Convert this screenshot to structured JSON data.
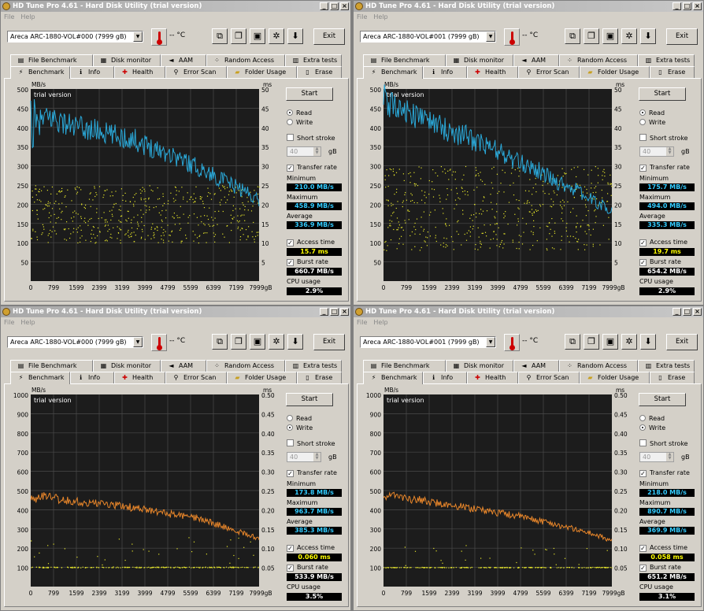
{
  "app_title": "HD Tune Pro 4.61 - Hard Disk Utility (trial version)",
  "menu": [
    "File",
    "Help"
  ],
  "temp_text": "-- °C",
  "exit_label": "Exit",
  "tabs_row1": [
    "File Benchmark",
    "Disk monitor",
    "AAM",
    "Random Access",
    "Extra tests"
  ],
  "tabs_row2": [
    "Benchmark",
    "Info",
    "Health",
    "Error Scan",
    "Folder Usage",
    "Erase"
  ],
  "start_label": "Start",
  "read_label": "Read",
  "write_label": "Write",
  "short_stroke_label": "Short stroke",
  "short_stroke_value": "40",
  "short_stroke_unit": "gB",
  "transfer_rate_label": "Transfer rate",
  "minimum_label": "Minimum",
  "maximum_label": "Maximum",
  "average_label": "Average",
  "access_time_label": "Access time",
  "burst_rate_label": "Burst rate",
  "cpu_usage_label": "CPU usage",
  "watermark": "trial version",
  "icons": [
    "copy-icon",
    "copy-all-icon",
    "save-icon",
    "options-icon",
    "download-icon"
  ],
  "colors": {
    "read_line": "#2aa8d8",
    "write_line": "#e8862a",
    "scatter": "#e6e62a",
    "grid_bg": "#1c1c1c"
  },
  "windows": [
    {
      "drive": "Areca   ARC-1880-VOL#000 (7999 gB)",
      "mode": "read",
      "minimum": "210.0 MB/s",
      "maximum": "458.9 MB/s",
      "average": "336.9 MB/s",
      "access_time": "15.7 ms",
      "burst_rate": "660.7 MB/s",
      "cpu_usage": "2.9%"
    },
    {
      "drive": "Areca   ARC-1880-VOL#001 (7999 gB)",
      "mode": "read",
      "minimum": "175.7 MB/s",
      "maximum": "494.0 MB/s",
      "average": "335.3 MB/s",
      "access_time": "19.7 ms",
      "burst_rate": "654.2 MB/s",
      "cpu_usage": "2.9%"
    },
    {
      "drive": "Areca   ARC-1880-VOL#000 (7999 gB)",
      "mode": "write",
      "minimum": "173.8 MB/s",
      "maximum": "963.7 MB/s",
      "average": "385.3 MB/s",
      "access_time": "0.060 ms",
      "burst_rate": "533.9 MB/s",
      "cpu_usage": "3.5%"
    },
    {
      "drive": "Areca   ARC-1880-VOL#001 (7999 gB)",
      "mode": "write",
      "minimum": "218.0 MB/s",
      "maximum": "890.7 MB/s",
      "average": "369.9 MB/s",
      "access_time": "0.058 ms",
      "burst_rate": "651.2 MB/s",
      "cpu_usage": "3.1%"
    }
  ],
  "chart_data": [
    {
      "type": "line",
      "title": "",
      "xlabel": "gB",
      "ylabel": "MB/s",
      "y2label": "ms",
      "x_ticks": [
        "0",
        "799",
        "1599",
        "2399",
        "3199",
        "3999",
        "4799",
        "5599",
        "6399",
        "7199",
        "7999gB"
      ],
      "y_ticks": [
        "500",
        "450",
        "400",
        "350",
        "300",
        "250",
        "200",
        "150",
        "100",
        "50"
      ],
      "y2_ticks": [
        "50",
        "45",
        "40",
        "35",
        "30",
        "25",
        "20",
        "15",
        "10",
        "5"
      ],
      "xlim": [
        0,
        8000
      ],
      "ylim": [
        0,
        500
      ],
      "y2lim": [
        0,
        50
      ],
      "series": [
        {
          "x": [
            0,
            400,
            800,
            1200,
            1600,
            2000,
            2400,
            2800,
            3200,
            3600,
            4000,
            4400,
            4800,
            5200,
            5600,
            6000,
            6400,
            6800,
            7200,
            7600,
            8000
          ],
          "values": [
            390,
            420,
            425,
            410,
            400,
            395,
            390,
            380,
            375,
            370,
            355,
            345,
            335,
            320,
            305,
            290,
            275,
            260,
            245,
            230,
            210
          ]
        }
      ],
      "access_scatter_range_ms": [
        10,
        25
      ]
    },
    {
      "type": "line",
      "title": "",
      "xlabel": "gB",
      "ylabel": "MB/s",
      "y2label": "ms",
      "x_ticks": [
        "0",
        "799",
        "1599",
        "2399",
        "3199",
        "3999",
        "4799",
        "5599",
        "6399",
        "7199",
        "7999gB"
      ],
      "y_ticks": [
        "500",
        "450",
        "400",
        "350",
        "300",
        "250",
        "200",
        "150",
        "100",
        "50"
      ],
      "y2_ticks": [
        "50",
        "45",
        "40",
        "35",
        "30",
        "25",
        "20",
        "15",
        "10",
        "5"
      ],
      "xlim": [
        0,
        8000
      ],
      "ylim": [
        0,
        500
      ],
      "y2lim": [
        0,
        50
      ],
      "series": [
        {
          "x": [
            0,
            400,
            800,
            1200,
            1600,
            2000,
            2400,
            2800,
            3200,
            3600,
            4000,
            4400,
            4800,
            5200,
            5600,
            6000,
            6400,
            6800,
            7200,
            7600,
            8000
          ],
          "values": [
            450,
            460,
            440,
            430,
            420,
            400,
            390,
            380,
            365,
            350,
            340,
            320,
            305,
            300,
            280,
            260,
            250,
            235,
            215,
            200,
            180
          ]
        }
      ],
      "access_scatter_range_ms": [
        8,
        30
      ]
    },
    {
      "type": "line",
      "title": "",
      "xlabel": "gB",
      "ylabel": "MB/s",
      "y2label": "ms",
      "x_ticks": [
        "0",
        "799",
        "1599",
        "2399",
        "3199",
        "3999",
        "4799",
        "5599",
        "6399",
        "7199",
        "7999gB"
      ],
      "y_ticks": [
        "1000",
        "900",
        "800",
        "700",
        "600",
        "500",
        "400",
        "300",
        "200",
        "100"
      ],
      "y2_ticks": [
        "0.50",
        "0.45",
        "0.40",
        "0.35",
        "0.30",
        "0.25",
        "0.20",
        "0.15",
        "0.10",
        "0.05"
      ],
      "xlim": [
        0,
        8000
      ],
      "ylim": [
        0,
        1000
      ],
      "y2lim": [
        0,
        0.5
      ],
      "series": [
        {
          "x": [
            0,
            400,
            800,
            1200,
            1600,
            2000,
            2400,
            2800,
            3200,
            3600,
            4000,
            4400,
            4800,
            5200,
            5600,
            6000,
            6400,
            6800,
            7200,
            7600,
            8000
          ],
          "values": [
            450,
            470,
            460,
            450,
            445,
            440,
            430,
            425,
            420,
            410,
            400,
            390,
            380,
            370,
            360,
            350,
            330,
            310,
            290,
            270,
            250
          ]
        }
      ],
      "access_scatter_range_ms": [
        0.05,
        0.07
      ]
    },
    {
      "type": "line",
      "title": "",
      "xlabel": "gB",
      "ylabel": "MB/s",
      "y2label": "ms",
      "x_ticks": [
        "0",
        "799",
        "1599",
        "2399",
        "3199",
        "3999",
        "4799",
        "5599",
        "6399",
        "7199",
        "7999gB"
      ],
      "y_ticks": [
        "1000",
        "900",
        "800",
        "700",
        "600",
        "500",
        "400",
        "300",
        "200",
        "100"
      ],
      "y2_ticks": [
        "0.50",
        "0.45",
        "0.40",
        "0.35",
        "0.30",
        "0.25",
        "0.20",
        "0.15",
        "0.10",
        "0.05"
      ],
      "xlim": [
        0,
        8000
      ],
      "ylim": [
        0,
        1000
      ],
      "y2lim": [
        0,
        0.5
      ],
      "series": [
        {
          "x": [
            0,
            400,
            800,
            1200,
            1600,
            2000,
            2400,
            2800,
            3200,
            3600,
            4000,
            4400,
            4800,
            5200,
            5600,
            6000,
            6400,
            6800,
            7200,
            7600,
            8000
          ],
          "values": [
            470,
            475,
            460,
            450,
            440,
            430,
            425,
            415,
            405,
            395,
            385,
            375,
            365,
            350,
            340,
            325,
            310,
            295,
            280,
            260,
            240
          ]
        }
      ],
      "access_scatter_range_ms": [
        0.05,
        0.065
      ]
    }
  ]
}
